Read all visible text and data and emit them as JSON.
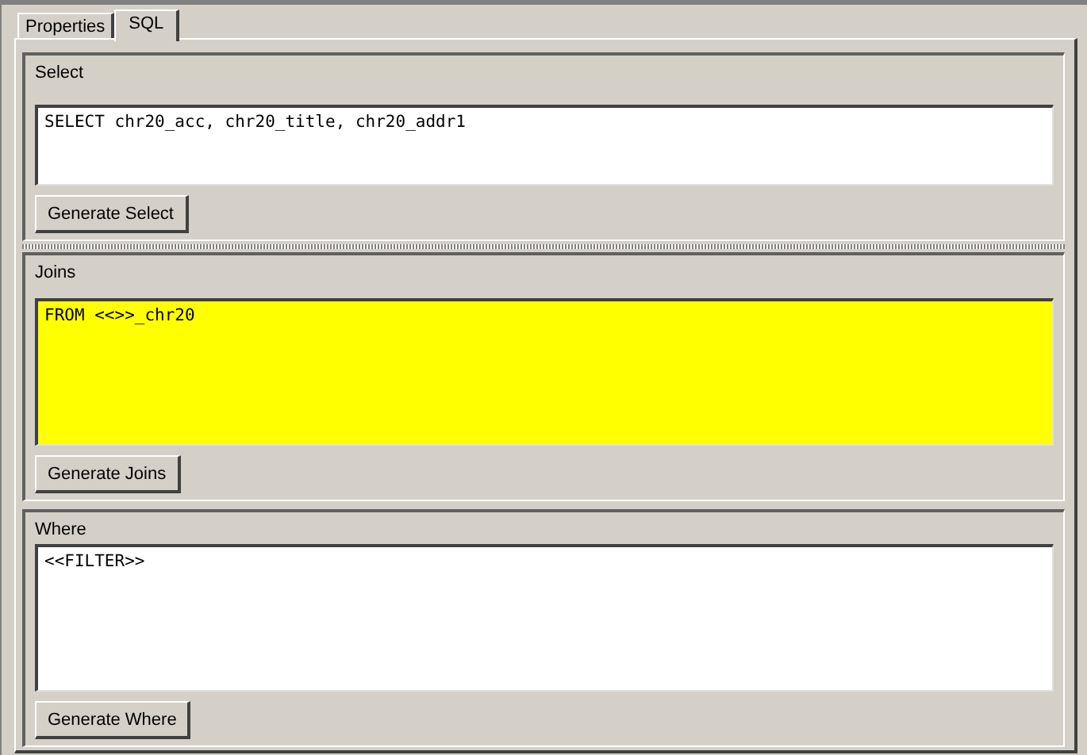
{
  "tabs": [
    {
      "label": "Properties",
      "selected": false
    },
    {
      "label": "SQL",
      "selected": true
    }
  ],
  "sections": [
    {
      "title": "Select",
      "text": "SELECT chr20_acc, chr20_title, chr20_addr1",
      "highlighted": false,
      "button": "Generate Select"
    },
    {
      "title": "Joins",
      "text": "FROM <<>>_chr20",
      "highlighted": true,
      "button": "Generate Joins"
    },
    {
      "title": "Where",
      "text": "<<FILTER>>",
      "highlighted": false,
      "button": "Generate Where"
    }
  ]
}
